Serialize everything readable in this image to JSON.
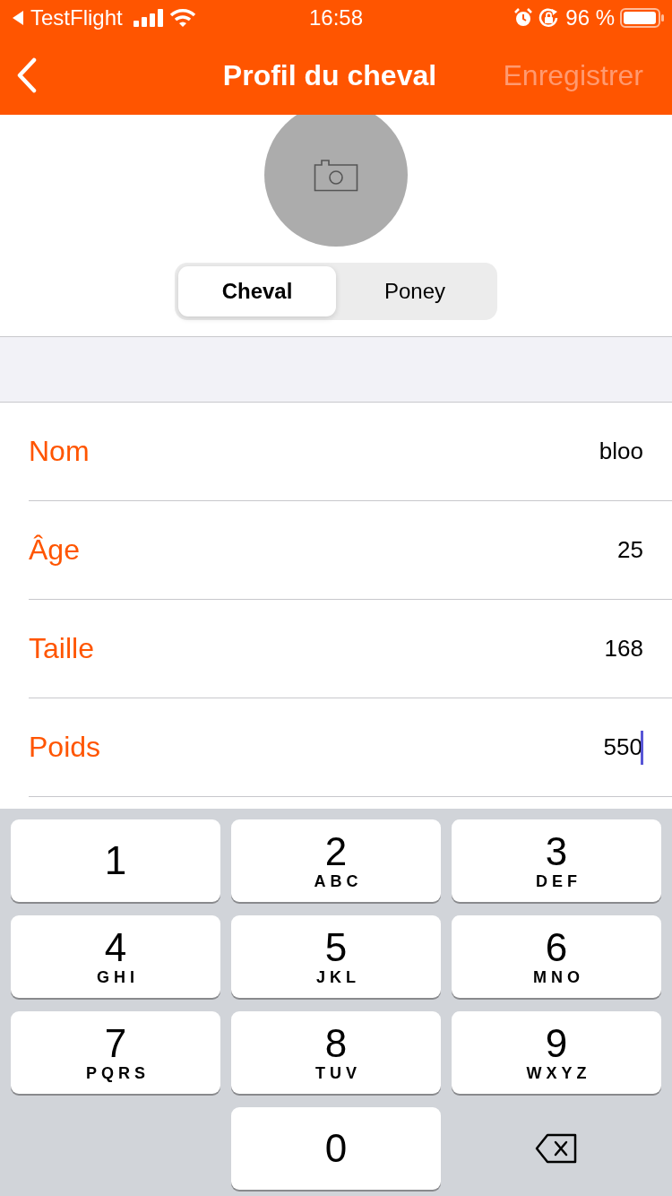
{
  "status_bar": {
    "back_app": "TestFlight",
    "time": "16:58",
    "battery": "96 %"
  },
  "nav": {
    "title": "Profil du cheval",
    "save": {
      "label": "Enregistrer",
      "disabled": true
    }
  },
  "segments": [
    {
      "label": "Cheval",
      "selected": true
    },
    {
      "label": "Poney",
      "selected": false
    }
  ],
  "fields": [
    {
      "label": "Nom",
      "value": "bloo",
      "focused": false
    },
    {
      "label": "Âge",
      "value": "25",
      "focused": false
    },
    {
      "label": "Taille",
      "value": "168",
      "focused": false
    },
    {
      "label": "Poids",
      "value": "550",
      "focused": true
    }
  ],
  "keypad": [
    {
      "kind": "digit",
      "digit": "1"
    },
    {
      "kind": "digit",
      "digit": "2",
      "letters": "ABC"
    },
    {
      "kind": "digit",
      "digit": "3",
      "letters": "DEF"
    },
    {
      "kind": "digit",
      "digit": "4",
      "letters": "GHI"
    },
    {
      "kind": "digit",
      "digit": "5",
      "letters": "JKL"
    },
    {
      "kind": "digit",
      "digit": "6",
      "letters": "MNO"
    },
    {
      "kind": "digit",
      "digit": "7",
      "letters": "PQRS"
    },
    {
      "kind": "digit",
      "digit": "8",
      "letters": "TUV"
    },
    {
      "kind": "digit",
      "digit": "9",
      "letters": "WXYZ"
    },
    {
      "kind": "blank"
    },
    {
      "kind": "digit",
      "digit": "0"
    },
    {
      "kind": "delete"
    }
  ]
}
